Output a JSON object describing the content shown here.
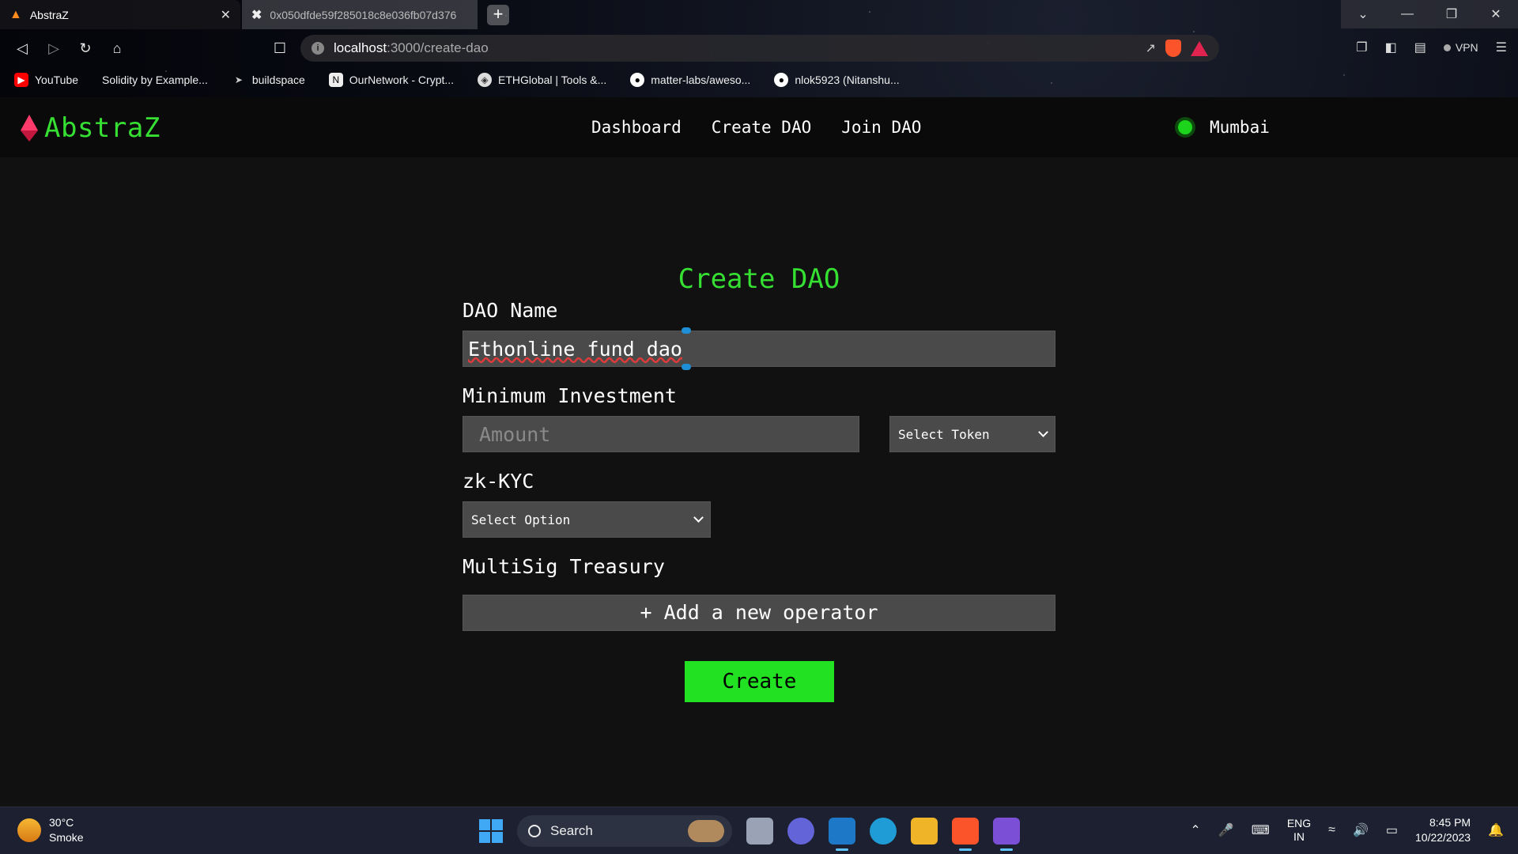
{
  "browser": {
    "tabs": [
      {
        "title": "AbstraZ",
        "active": true
      },
      {
        "title": "0x050dfde59f285018c8e036fb07d376",
        "active": false
      }
    ],
    "url_host": "localhost",
    "url_path": ":3000/create-dao",
    "vpn_label": "VPN",
    "bookmarks": [
      {
        "label": "YouTube",
        "icon": "youtube-icon"
      },
      {
        "label": "Solidity by Example...",
        "icon": "none"
      },
      {
        "label": "buildspace",
        "icon": "buildspace-icon"
      },
      {
        "label": "OurNetwork - Crypt...",
        "icon": "ournetwork-icon"
      },
      {
        "label": "ETHGlobal | Tools &...",
        "icon": "ethglobal-icon"
      },
      {
        "label": "matter-labs/aweso...",
        "icon": "github-icon"
      },
      {
        "label": "nlok5923 (Nitanshu...",
        "icon": "github-icon"
      }
    ]
  },
  "app": {
    "logo_text": "AbstraZ",
    "nav_links": [
      "Dashboard",
      "Create DAO",
      "Join DAO"
    ],
    "network_name": "Mumbai",
    "form": {
      "title": "Create DAO",
      "dao_name_label": "DAO Name",
      "dao_name_value": "Ethonline fund dao",
      "min_investment_label": "Minimum Investment",
      "amount_placeholder": "Amount",
      "token_select": "Select Token",
      "zkkyc_label": "zk-KYC",
      "zkkyc_select": "Select Option",
      "treasury_label": "MultiSig Treasury",
      "add_operator": "+ Add a new operator",
      "create_button": "Create"
    },
    "colors": {
      "accent": "#36e033",
      "button": "#22e022",
      "logo_gem": "#ff3b6b"
    }
  },
  "taskbar": {
    "weather_temp": "30°C",
    "weather_desc": "Smoke",
    "search_label": "Search",
    "lang_top": "ENG",
    "lang_bottom": "IN",
    "time": "8:45 PM",
    "date": "10/22/2023"
  }
}
